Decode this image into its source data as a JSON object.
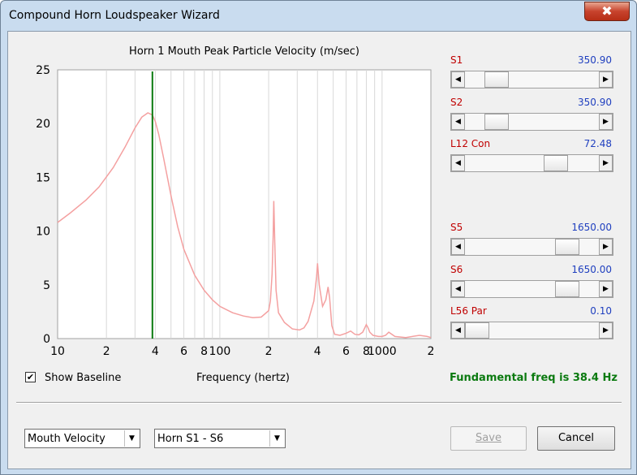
{
  "window": {
    "title": "Compound Horn Loudspeaker Wizard",
    "close_symbol": "✖"
  },
  "chart_data": {
    "type": "line",
    "title": "Horn 1 Mouth Peak Particle Velocity (m/sec)",
    "xlabel": "Frequency (hertz)",
    "ylabel": "",
    "xscale": "log",
    "xlim": [
      10,
      2000
    ],
    "ylim": [
      0,
      25
    ],
    "yticks": [
      "0",
      "5",
      "10",
      "15",
      "20",
      "25"
    ],
    "xtick_labels": [
      "10",
      "2",
      "4",
      "6",
      "8",
      "100",
      "2",
      "4",
      "6",
      "8",
      "1000",
      "2"
    ],
    "xtick_values": [
      10,
      20,
      40,
      60,
      80,
      100,
      200,
      400,
      600,
      800,
      1000,
      2000
    ],
    "grid": true,
    "marker_freq": 38.4,
    "series": [
      {
        "color": "#f4a0a0",
        "x": [
          10,
          12,
          15,
          18,
          22,
          26,
          30,
          33,
          36,
          38.4,
          40,
          42,
          45,
          50,
          55,
          60,
          70,
          80,
          90,
          100,
          120,
          140,
          160,
          180,
          200,
          205,
          210,
          213,
          215,
          218,
          222,
          230,
          250,
          280,
          310,
          330,
          350,
          380,
          395,
          400,
          410,
          430,
          450,
          465,
          475,
          490,
          510,
          550,
          600,
          640,
          680,
          720,
          760,
          800,
          820,
          840,
          880,
          950,
          1000,
          1050,
          1100,
          1200,
          1400,
          1700,
          1900,
          2000
        ],
        "y": [
          10.8,
          11.7,
          12.9,
          14.1,
          15.9,
          17.8,
          19.6,
          20.6,
          21.0,
          20.8,
          20.2,
          19.0,
          16.8,
          13.3,
          10.4,
          8.3,
          5.9,
          4.5,
          3.6,
          3.0,
          2.4,
          2.1,
          1.95,
          2.0,
          2.6,
          3.5,
          6.0,
          9.5,
          12.8,
          9.0,
          4.5,
          2.4,
          1.5,
          0.9,
          0.8,
          1.0,
          1.6,
          3.5,
          5.8,
          7.0,
          5.0,
          3.0,
          3.6,
          4.8,
          3.8,
          1.2,
          0.4,
          0.3,
          0.5,
          0.7,
          0.4,
          0.35,
          0.6,
          1.3,
          1.0,
          0.6,
          0.3,
          0.2,
          0.2,
          0.3,
          0.6,
          0.2,
          0.1,
          0.3,
          0.2,
          0.1
        ]
      }
    ]
  },
  "sliders": [
    {
      "label": "S1",
      "value": "350.90",
      "position": 0.18
    },
    {
      "label": "S2",
      "value": "350.90",
      "position": 0.18
    },
    {
      "label": "L12  Con",
      "value": "72.48",
      "position": 0.72
    },
    {
      "label": "S5",
      "value": "1650.00",
      "position": 0.82
    },
    {
      "label": "S6",
      "value": "1650.00",
      "position": 0.82
    },
    {
      "label": "L56  Par",
      "value": "0.10",
      "position": 0.0
    }
  ],
  "scroll_arrows": {
    "left": "◀",
    "right": "▶"
  },
  "checkbox": {
    "checked_symbol": "✔",
    "label": "Show Baseline"
  },
  "fundamental_text": "Fundamental freq is 38.4 Hz",
  "combo_arrow": "▼",
  "combo1": {
    "value": "Mouth Velocity"
  },
  "combo2": {
    "value": "Horn S1 - S6"
  },
  "buttons": {
    "save": "Save",
    "cancel": "Cancel"
  }
}
